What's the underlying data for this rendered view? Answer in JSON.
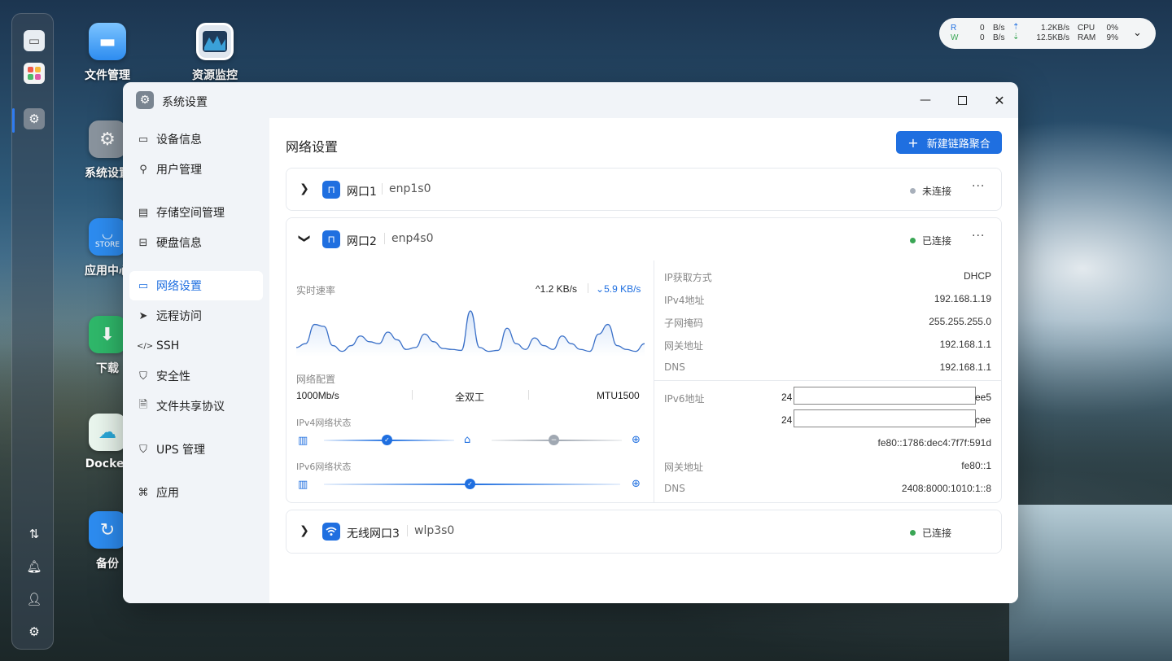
{
  "dock": {
    "items": [
      {
        "name": "monitor"
      },
      {
        "name": "apps-grid"
      },
      {
        "name": "settings"
      },
      {
        "name": "transfer"
      },
      {
        "name": "bell"
      },
      {
        "name": "user"
      },
      {
        "name": "gear"
      }
    ]
  },
  "desktop": {
    "icons": [
      {
        "label": "文件管理"
      },
      {
        "label": "资源监控"
      },
      {
        "label": "系统设置"
      },
      {
        "label": "应用中心"
      },
      {
        "label": "下载"
      },
      {
        "label": "Docker"
      },
      {
        "label": "备份"
      }
    ],
    "store_badge": "STORE"
  },
  "status_widget": {
    "r_label": "R",
    "w_label": "W",
    "r_value": "0",
    "r_unit": "B/s",
    "w_value": "0",
    "w_unit": "B/s",
    "up_value": "1.2KB/s",
    "down_value": "12.5KB/s",
    "cpu_label": "CPU",
    "cpu_value": "0%",
    "ram_label": "RAM",
    "ram_value": "9%",
    "accent_r": "#1f6fe0",
    "accent_w": "#3aa655"
  },
  "window": {
    "title": "系统设置"
  },
  "sidebar": {
    "items": [
      {
        "label": "设备信息",
        "icon": "device-icon"
      },
      {
        "label": "用户管理",
        "icon": "user-icon"
      },
      {
        "label": "存储空间管理",
        "icon": "storage-icon"
      },
      {
        "label": "硬盘信息",
        "icon": "disk-icon"
      },
      {
        "label": "网络设置",
        "icon": "network-icon",
        "active": true
      },
      {
        "label": "远程访问",
        "icon": "send-icon"
      },
      {
        "label": "SSH",
        "icon": "code-icon"
      },
      {
        "label": "安全性",
        "icon": "shield-check-icon"
      },
      {
        "label": "文件共享协议",
        "icon": "file-icon"
      },
      {
        "label": "UPS 管理",
        "icon": "shield-icon"
      },
      {
        "label": "应用",
        "icon": "apps-icon"
      }
    ]
  },
  "main": {
    "title": "网络设置",
    "add_button": "新建链路聚合",
    "ports": [
      {
        "name": "网口1",
        "device": "enp1s0",
        "status": "未连接",
        "status_color": "#a8b0bb"
      },
      {
        "name": "网口2",
        "device": "enp4s0",
        "status": "已连接",
        "status_color": "#3aa655"
      },
      {
        "name": "无线网口3",
        "device": "wlp3s0",
        "status": "已连接",
        "status_color": "#3aa655"
      }
    ],
    "detail": {
      "speed_label": "实时速率",
      "up_speed": "1.2 KB/s",
      "down_speed": "5.9 KB/s",
      "config_label": "网络配置",
      "link_speed": "1000Mb/s",
      "duplex": "全双工",
      "mtu": "MTU1500",
      "ipv4_state_label": "IPv4网络状态",
      "ipv6_state_label": "IPv6网络状态",
      "chart_series": [
        6,
        10,
        30,
        28,
        8,
        2,
        8,
        18,
        12,
        10,
        22,
        14,
        4,
        6,
        20,
        12,
        5,
        4,
        3,
        44,
        6,
        2,
        3,
        26,
        10,
        4,
        16,
        8,
        4,
        18,
        10,
        4,
        2,
        20,
        30,
        8,
        4,
        2,
        10
      ],
      "ipv4": [
        {
          "key": "IP获取方式",
          "value": "DHCP"
        },
        {
          "key": "IPv4地址",
          "value": "192.168.1.19"
        },
        {
          "key": "子网掩码",
          "value": "255.255.255.0"
        },
        {
          "key": "网关地址",
          "value": "192.168.1.1"
        },
        {
          "key": "DNS",
          "value": "192.168.1.1"
        }
      ],
      "ipv6": {
        "address_label": "IPv6地址",
        "addr1_prefix": "24",
        "addr1_suffix": "ee5",
        "addr2_prefix": "24",
        "addr2_suffix": "cee",
        "addr3": "fe80::1786:dec4:7f7f:591d",
        "gateway_label": "网关地址",
        "gateway": "fe80::1",
        "dns_label": "DNS",
        "dns": "2408:8000:1010:1::8"
      }
    }
  }
}
